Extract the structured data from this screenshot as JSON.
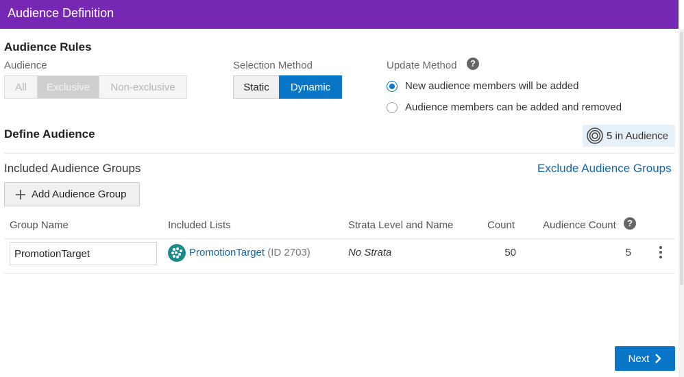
{
  "header": {
    "title": "Audience Definition"
  },
  "audience_rules": {
    "heading": "Audience Rules",
    "audience": {
      "label": "Audience",
      "options": [
        "All",
        "Exclusive",
        "Non-exclusive"
      ],
      "selected": "Exclusive"
    },
    "selection_method": {
      "label": "Selection Method",
      "options": [
        "Static",
        "Dynamic"
      ],
      "selected": "Dynamic"
    },
    "update_method": {
      "label": "Update Method",
      "help_icon": "help-icon",
      "options": [
        "New audience members will be added",
        "Audience members can be added and removed"
      ],
      "selected": "New audience members will be added"
    }
  },
  "define_audience": {
    "heading": "Define Audience",
    "count_badge": "5 in Audience",
    "count_icon": "target-icon",
    "included_groups_title": "Included Audience Groups",
    "exclude_link": "Exclude Audience Groups",
    "add_group_button": "Add Audience Group",
    "table": {
      "columns": [
        "Group Name",
        "Included Lists",
        "Strata Level and Name",
        "Count",
        "Audience Count"
      ],
      "rows": [
        {
          "group_name": "PromotionTarget",
          "list_name": "PromotionTarget",
          "list_id": "(ID 2703)",
          "strata": "No Strata",
          "count": "50",
          "audience_count": "5"
        }
      ]
    }
  },
  "footer": {
    "next_button": "Next"
  },
  "colors": {
    "header": "#7627b3",
    "primary": "#0a76c7",
    "link": "#1566a8",
    "list_icon": "#1b8a8c",
    "badge_bg": "#e6f0f8"
  }
}
